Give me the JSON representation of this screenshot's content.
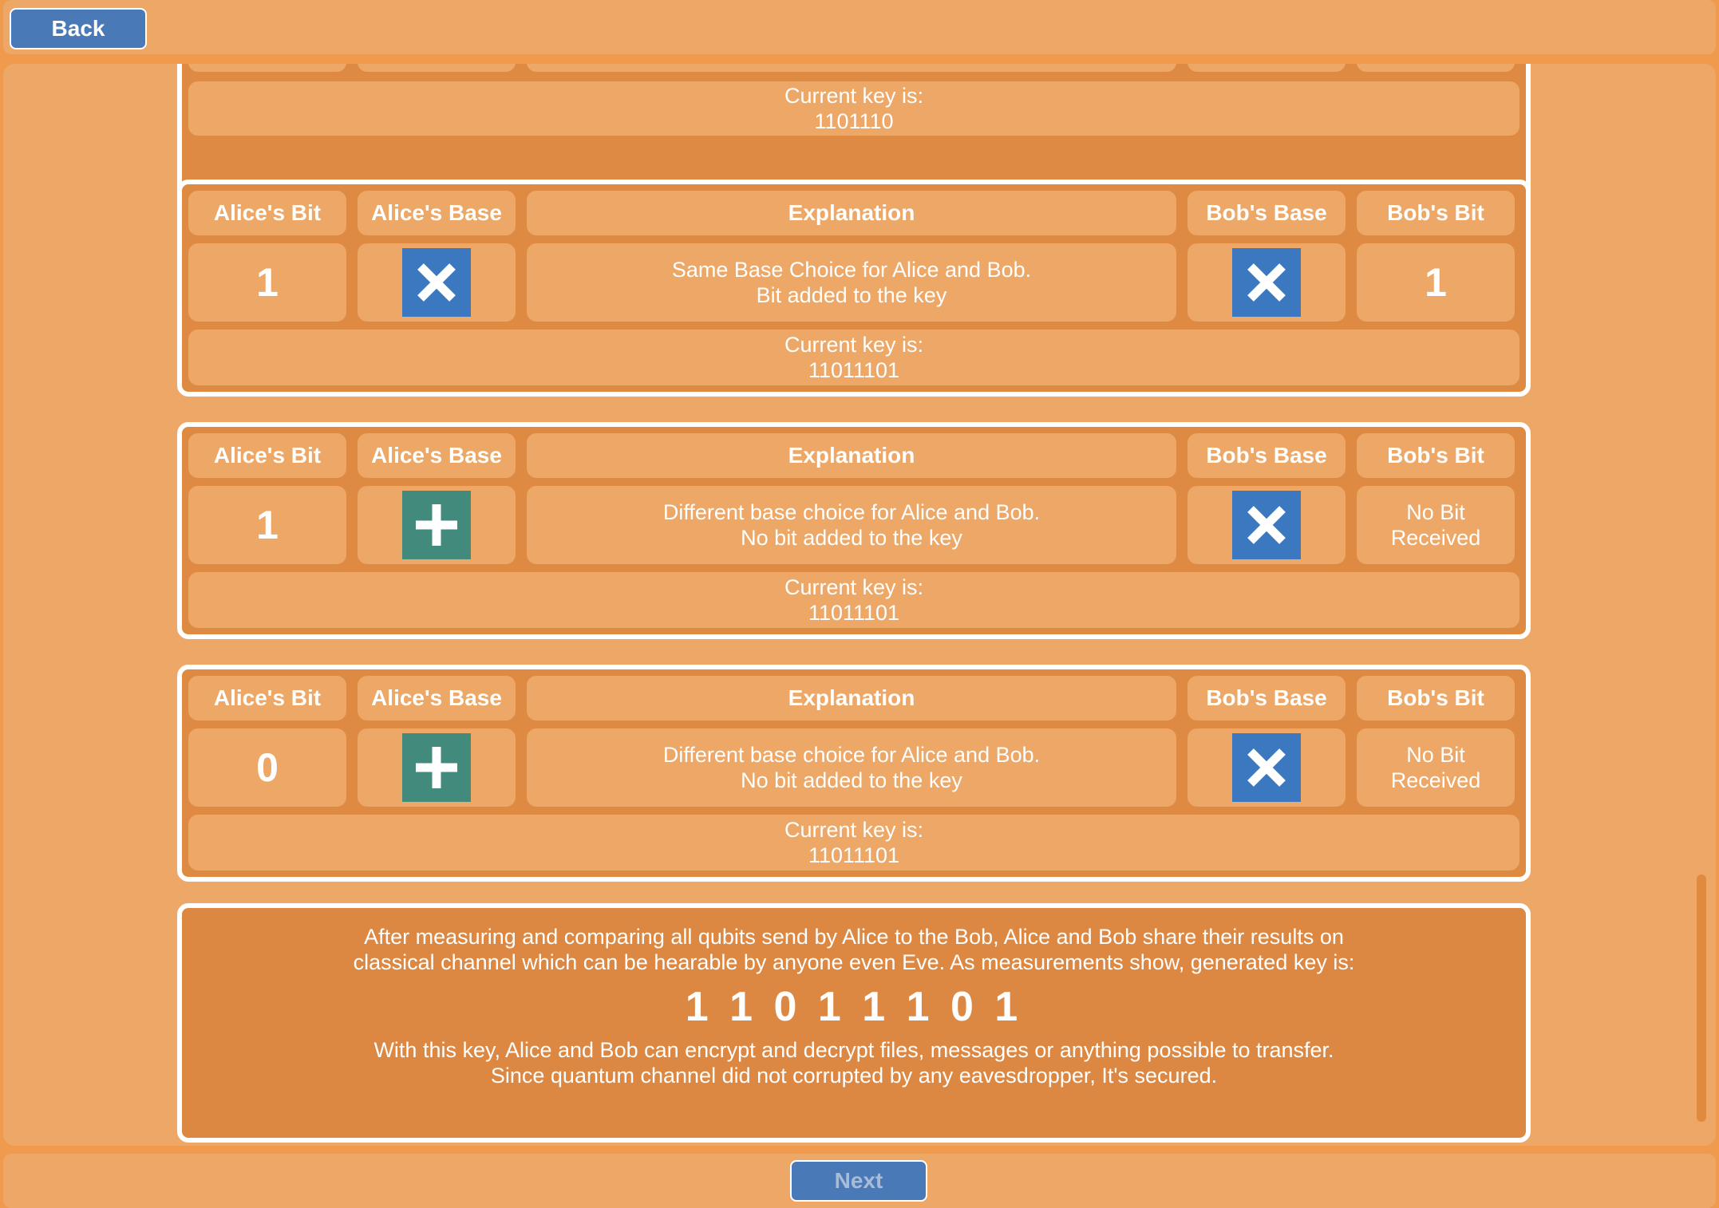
{
  "nav": {
    "back_label": "Back",
    "next_label": "Next"
  },
  "headers": {
    "alice_bit": "Alice's Bit",
    "alice_base": "Alice's Base",
    "explanation": "Explanation",
    "bob_base": "Bob's Base",
    "bob_bit": "Bob's Bit"
  },
  "key_label": "Current key is:",
  "rounds": [
    {
      "key": "1101110"
    },
    {
      "alice_bit": "1",
      "alice_base": "x-icon",
      "explanation_line1": "Same Base Choice for Alice and Bob.",
      "explanation_line2": "Bit added to the key",
      "bob_base": "x-icon",
      "bob_bit": "1",
      "key": "11011101"
    },
    {
      "alice_bit": "1",
      "alice_base": "plus-icon",
      "explanation_line1": "Different base choice for Alice and Bob.",
      "explanation_line2": "No bit added to the key",
      "bob_base": "x-icon",
      "bob_bit_line1": "No Bit",
      "bob_bit_line2": "Received",
      "key": "11011101"
    },
    {
      "alice_bit": "0",
      "alice_base": "plus-icon",
      "explanation_line1": "Different base choice for Alice and Bob.",
      "explanation_line2": "No bit added to the key",
      "bob_base": "x-icon",
      "bob_bit_line1": "No Bit",
      "bob_bit_line2": "Received",
      "key": "11011101"
    }
  ],
  "summary": {
    "intro": "After measuring and comparing all qubits send by Alice to the Bob, Alice and Bob share their results on classical channel which can be hearable by anyone even Eve. As measurements show, generated key is:",
    "key": "1 1 0 1 1 1 0 1",
    "outro_line1": "With this key, Alice and Bob can encrypt and decrypt files, messages or anything possible to transfer.",
    "outro_line2": "Since quantum channel did not corrupted by any eavesdropper, It's secured."
  },
  "colors": {
    "background": "#ef9a4d",
    "panel": "#eda766",
    "card": "#df8a43",
    "x_base": "#3b78c0",
    "plus_base": "#418a7c",
    "button": "#4a79b8"
  }
}
